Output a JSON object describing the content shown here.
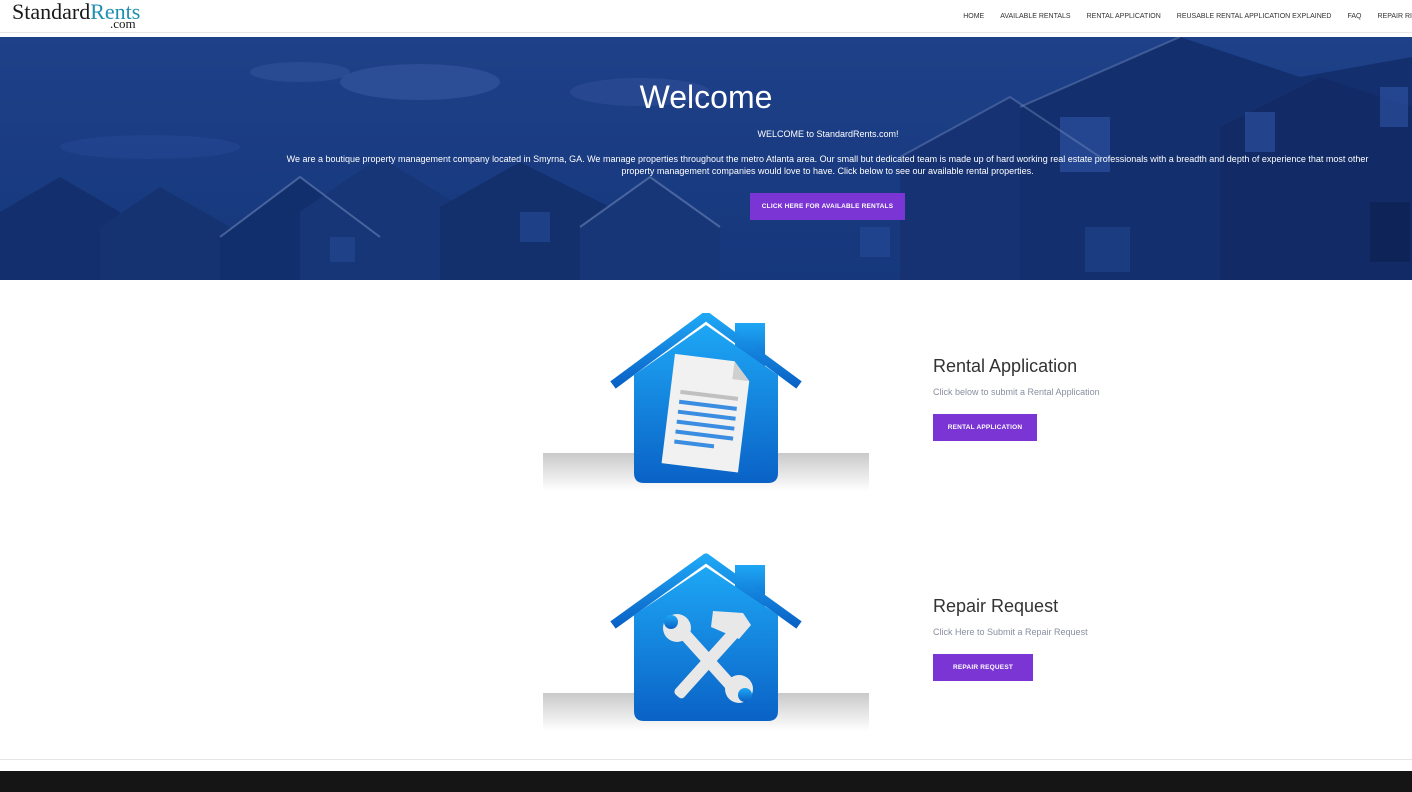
{
  "site": {
    "logo_main": "Standard",
    "logo_accent": "Rents",
    "logo_sub": ".com"
  },
  "nav": {
    "items": [
      {
        "label": "HOME"
      },
      {
        "label": "AVAILABLE RENTALS"
      },
      {
        "label": "RENTAL APPLICATION"
      },
      {
        "label": "REUSABLE RENTAL APPLICATION EXPLAINED"
      },
      {
        "label": "FAQ"
      },
      {
        "label": "REPAIR RI"
      }
    ]
  },
  "hero": {
    "title": "Welcome",
    "subtitle": "WELCOME to StandardRents.com!",
    "body": "We are a boutique property management company located in Smyrna, GA. We manage properties throughout the metro Atlanta area. Our small but dedicated team is made up of hard working real estate professionals with a breadth and depth of experience that most other property management companies would love to have. Click below to see our available rental properties.",
    "button": "CLICK HERE FOR AVAILABLE RENTALS"
  },
  "features": [
    {
      "title": "Rental Application",
      "description": "Click below to submit a Rental Application",
      "button": "RENTAL APPLICATION",
      "icon": "house-document-icon"
    },
    {
      "title": "Repair Request",
      "description": "Click Here to Submit a Repair Request",
      "button": "REPAIR REQUEST",
      "icon": "house-tools-icon"
    }
  ],
  "colors": {
    "accent_purple": "#7a35d4",
    "hero_blue": "#1d3f86",
    "icon_blue_top": "#1ea7f5",
    "icon_blue_bottom": "#0a64c8",
    "footer": "#151515"
  }
}
